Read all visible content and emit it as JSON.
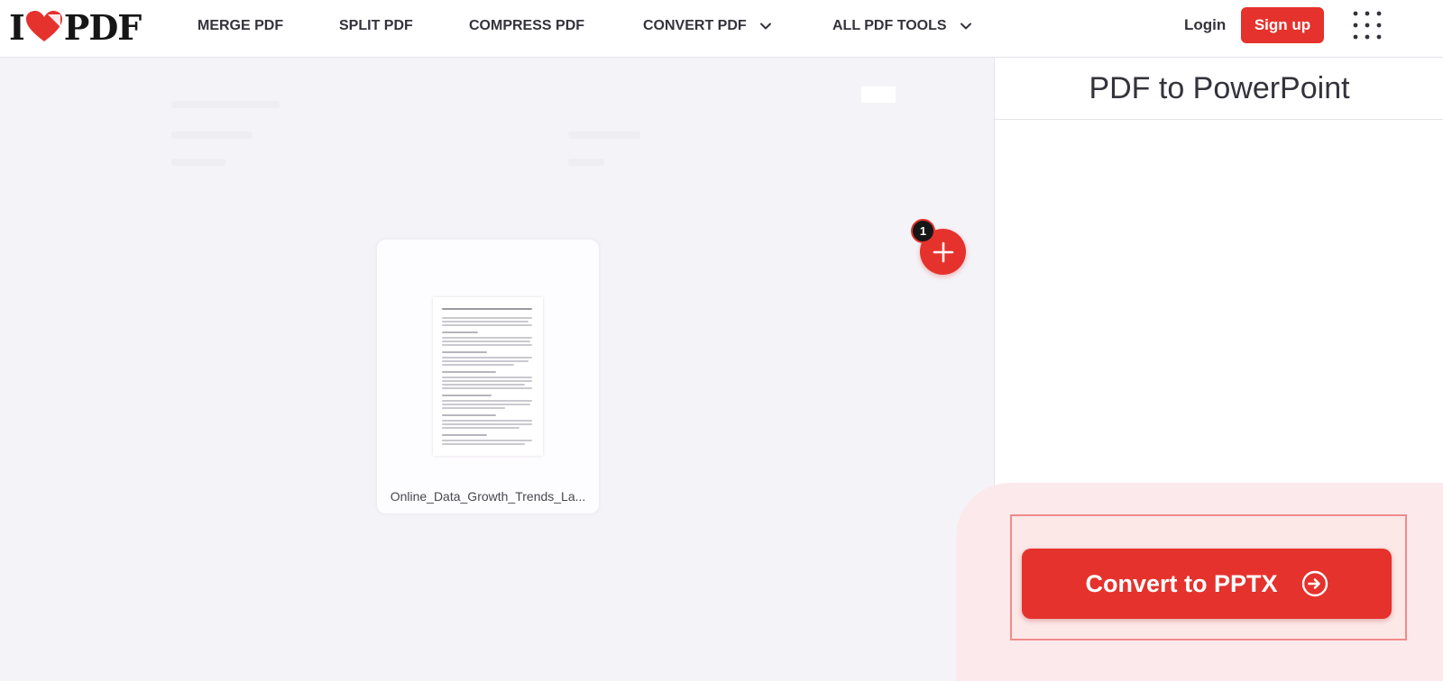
{
  "brand": {
    "logo_left": "I",
    "logo_right": "PDF"
  },
  "nav": {
    "items": [
      {
        "label": "MERGE PDF"
      },
      {
        "label": "SPLIT PDF"
      },
      {
        "label": "COMPRESS PDF"
      },
      {
        "label": "CONVERT PDF",
        "dropdown": true
      },
      {
        "label": "ALL PDF TOOLS",
        "dropdown": true
      }
    ],
    "login": "Login",
    "signup": "Sign up"
  },
  "workspace": {
    "file_name": "Online_Data_Growth_Trends_La...",
    "file_count": "1"
  },
  "sidebar": {
    "title": "PDF to PowerPoint",
    "convert_label": "Convert to PPTX"
  },
  "colors": {
    "accent": "#e5322d",
    "text": "#33333b",
    "background": "#f4f4f8"
  },
  "icons": [
    "heart-icon",
    "chevron-down-icon",
    "apps-grid-icon",
    "plus-icon",
    "arrow-right-circle-icon"
  ]
}
